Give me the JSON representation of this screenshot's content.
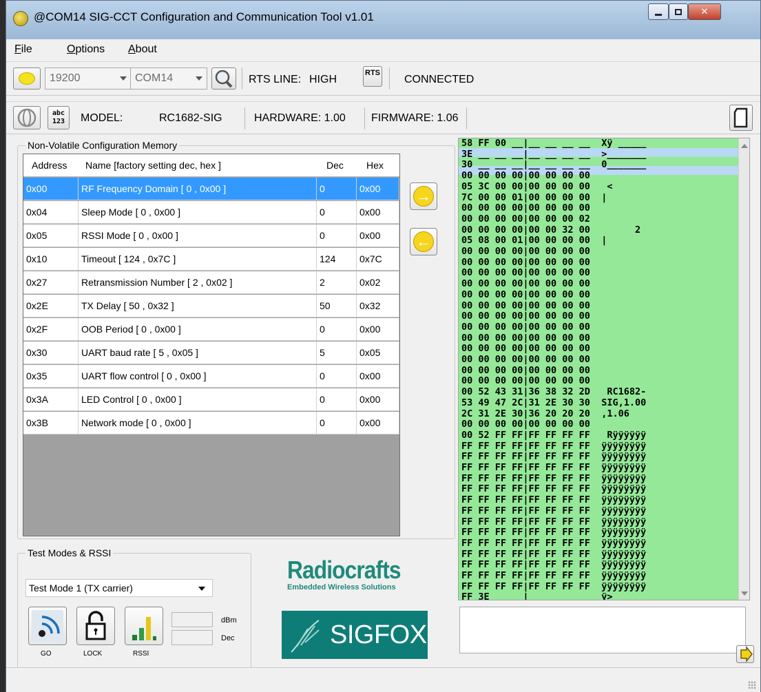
{
  "window": {
    "title": "@COM14 SIG-CCT Configuration and Communication Tool v1.01"
  },
  "menu": [
    {
      "label": "File",
      "key": "F",
      "rest": "ile"
    },
    {
      "label": "Options",
      "key": "O",
      "rest": "ptions"
    },
    {
      "label": "About",
      "key": "A",
      "rest": "bout"
    }
  ],
  "toolbar1": {
    "baud": "19200",
    "port": "COM14",
    "rts_label": "RTS LINE:",
    "rts_value": "HIGH",
    "rts_button": "RTS",
    "status": "CONNECTED"
  },
  "toolbar2": {
    "abc_top": "abc",
    "abc_bottom": "123",
    "model_label": "MODEL:",
    "model_value": "RC1682-SIG",
    "hardware": "HARDWARE: 1.00",
    "firmware": "FIRMWARE: 1.06"
  },
  "config": {
    "group_title": "Non-Volatile Configuration Memory",
    "headers": {
      "address": "Address",
      "name": "Name  [factory setting dec, hex ]",
      "dec": "Dec",
      "hex": "Hex"
    },
    "rows": [
      {
        "address": "0x00",
        "name": "RF Frequency Domain [ 0 , 0x00 ]",
        "dec": "0",
        "hex": "0x00"
      },
      {
        "address": "0x04",
        "name": "Sleep Mode [ 0 , 0x00 ]",
        "dec": "0",
        "hex": "0x00"
      },
      {
        "address": "0x05",
        "name": "RSSI Mode [ 0 , 0x00 ]",
        "dec": "0",
        "hex": "0x00"
      },
      {
        "address": "0x10",
        "name": "Timeout [ 124 , 0x7C ]",
        "dec": "124",
        "hex": "0x7C"
      },
      {
        "address": "0x27",
        "name": "Retransmission Number [ 2 , 0x02 ]",
        "dec": "2",
        "hex": "0x02"
      },
      {
        "address": "0x2E",
        "name": "TX Delay [ 50 , 0x32 ]",
        "dec": "50",
        "hex": "0x32"
      },
      {
        "address": "0x2F",
        "name": "OOB Period [ 0 , 0x00 ]",
        "dec": "0",
        "hex": "0x00"
      },
      {
        "address": "0x30",
        "name": "UART baud rate [ 5 , 0x05 ]",
        "dec": "5",
        "hex": "0x05"
      },
      {
        "address": "0x35",
        "name": "UART flow control [ 0 , 0x00 ]",
        "dec": "0",
        "hex": "0x00"
      },
      {
        "address": "0x3A",
        "name": "LED Control [ 0 , 0x00 ]",
        "dec": "0",
        "hex": "0x00"
      },
      {
        "address": "0x3B",
        "name": "Network mode [ 0 , 0x00 ]",
        "dec": "0",
        "hex": "0x00"
      }
    ]
  },
  "test": {
    "group_title": "Test Modes & RSSI",
    "mode_selected": "Test Mode 1 (TX carrier)",
    "go_label": "GO",
    "lock_label": "LOCK",
    "rssi_label": "RSSI",
    "dbm_unit": "dBm",
    "dec_unit": "Dec"
  },
  "logos": {
    "radiocrafts": "Radiocrafts",
    "radiocrafts_tagline": "Embedded Wireless Solutions",
    "sigfox": "SIGFOX"
  },
  "hex_dump": [
    "58 FF 00 __|__ __ __ __  Xÿ _____",
    "3E __ __ __|__ __ __ __  >_______",
    "30 __ __ __|__ __ __ __  0_______",
    "00 00 00 00|00 00 00 00          ",
    "05 3C 00 00|00 00 00 00   <      ",
    "7C 00 00 01|00 00 00 00  |       ",
    "00 00 00 00|00 00 00 00          ",
    "00 00 00 00|00 00 00 02          ",
    "00 00 00 00|00 00 32 00        2 ",
    "05 08 00 01|00 00 00 00  |       ",
    "00 00 00 00|00 00 00 00          ",
    "00 00 00 00|00 00 00 00          ",
    "00 00 00 00|00 00 00 00          ",
    "00 00 00 00|00 00 00 00          ",
    "00 00 00 00|00 00 00 00          ",
    "00 00 00 00|00 00 00 00          ",
    "00 00 00 00|00 00 00 00          ",
    "00 00 00 00|00 00 00 00          ",
    "00 00 00 00|00 00 00 00          ",
    "00 00 00 00|00 00 00 00          ",
    "00 00 00 00|00 00 00 00          ",
    "00 00 00 00|00 00 00 00          ",
    "00 00 00 00|00 00 00 00          ",
    "00 52 43 31|36 38 32 2D   RC1682-",
    "53 49 47 2C|31 2E 30 30  SIG,1.00",
    "2C 31 2E 30|36 20 20 20  ,1.06   ",
    "00 00 00 00|00 00 00 00          ",
    "00 52 FF FF|FF FF FF FF   Rÿÿÿÿÿÿ",
    "FF FF FF FF|FF FF FF FF  ÿÿÿÿÿÿÿÿ",
    "FF FF FF FF|FF FF FF FF  ÿÿÿÿÿÿÿÿ",
    "FF FF FF FF|FF FF FF FF  ÿÿÿÿÿÿÿÿ",
    "FF FF FF FF|FF FF FF FF  ÿÿÿÿÿÿÿÿ",
    "FF FF FF FF|FF FF FF FF  ÿÿÿÿÿÿÿÿ",
    "FF FF FF FF|FF FF FF FF  ÿÿÿÿÿÿÿÿ",
    "FF FF FF FF|FF FF FF FF  ÿÿÿÿÿÿÿÿ",
    "FF FF FF FF|FF FF FF FF  ÿÿÿÿÿÿÿÿ",
    "FF FF FF FF|FF FF FF FF  ÿÿÿÿÿÿÿÿ",
    "FF FF FF FF|FF FF FF FF  ÿÿÿÿÿÿÿÿ",
    "FF FF FF FF|FF FF FF FF  ÿÿÿÿÿÿÿÿ",
    "FF FF FF FF|FF FF FF FF  ÿÿÿÿÿÿÿÿ",
    "FF FF FF FF|FF FF FF FF  ÿÿÿÿÿÿÿÿ",
    "FF FF FF FF|FF FF FF FF  ÿÿÿÿÿÿÿÿ",
    "FF 3E __ __|__ __ __ __  ÿ>______"
  ],
  "colors": {
    "hex_bg": "#94e898",
    "selection": "#3399ff",
    "accent_yellow": "#f6d51e",
    "radiocrafts_green": "#1f8a7a"
  }
}
